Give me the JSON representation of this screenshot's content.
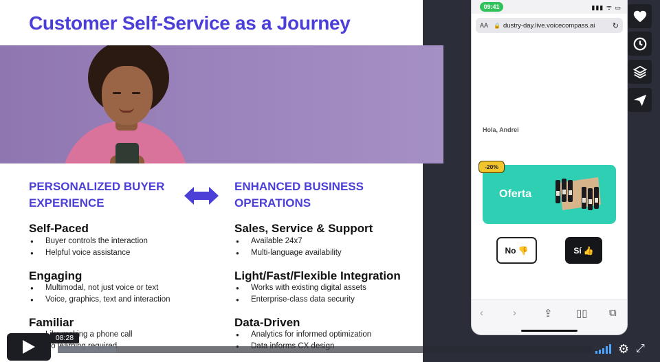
{
  "slide": {
    "title": "Customer Self-Service as a Journey",
    "left_heading": [
      "PERSONALIZED BUYER",
      "EXPERIENCE"
    ],
    "right_heading": [
      "ENHANCED BUSINESS",
      "OPERATIONS"
    ],
    "left_sections": [
      {
        "title": "Self-Paced",
        "bullets": [
          "Buyer controls the interaction",
          "Helpful voice assistance"
        ]
      },
      {
        "title": "Engaging",
        "bullets": [
          "Multimodal, not just voice or text",
          "Voice, graphics, text and interaction"
        ]
      },
      {
        "title": "Familiar",
        "bullets": [
          "Like making a phone call",
          "No learning required"
        ]
      }
    ],
    "right_sections": [
      {
        "title": "Sales, Service & Support",
        "bullets": [
          "Available 24x7",
          "Multi-language availability"
        ]
      },
      {
        "title": "Light/Fast/Flexible Integration",
        "bullets": [
          "Works with existing digital assets",
          "Enterprise-class data security"
        ]
      },
      {
        "title": "Data-Driven",
        "bullets": [
          "Analytics for informed optimization",
          "Data informs CX design"
        ]
      }
    ]
  },
  "phone": {
    "time": "09:41",
    "url_prefix": "AA",
    "url": "dustry-day.live.voicecompass.ai",
    "greeting": "Hola, Andrei",
    "badge": "-20%",
    "offer": "Oferta",
    "no_label": "No",
    "si_label": "Sí"
  },
  "sidebar": {
    "icons": [
      "heart-icon",
      "clock-icon",
      "layers-icon",
      "send-icon"
    ]
  },
  "player": {
    "time_tooltip": "08:28",
    "progress": 0.11
  }
}
